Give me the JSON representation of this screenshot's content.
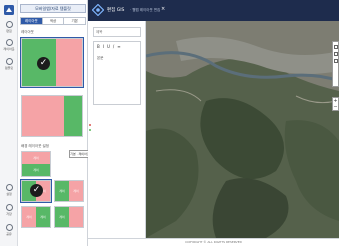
{
  "app": {
    "panel_title": "모바일앱/자료 템플릿",
    "header_title": "편집 GIS",
    "header_subtitle": "· 웹맵 레이아웃 편집",
    "footer_text": "COPYRIGHT © ALL RIGHTS RESERVED",
    "close_glyph": "×",
    "zoom_label": "+\n−"
  },
  "rail": {
    "items": [
      {
        "label": "편집",
        "icon": "home-icon"
      },
      {
        "label": "레이아웃",
        "icon": "layout-icon"
      },
      {
        "label": "템플릿",
        "icon": "template-icon"
      },
      {
        "label": "설정",
        "icon": "settings-icon"
      },
      {
        "label": "저장",
        "icon": "save-icon"
      },
      {
        "label": "공유",
        "icon": "share-icon"
      }
    ]
  },
  "tabs": [
    {
      "label": "레이아웃",
      "active": true
    },
    {
      "label": "색상",
      "active": false
    },
    {
      "label": "기본",
      "active": false
    }
  ],
  "sections": {
    "top_label": "레이아웃",
    "bottom_label": "배경 레이아웃 설정"
  },
  "layouts": {
    "check_glyph": "✓",
    "tooltip": "기본 · 레이아웃",
    "mini_cells": [
      "레이",
      "레이",
      "레이",
      "레이",
      "레이",
      "레이",
      "레이",
      "레이"
    ]
  },
  "tools": {
    "title_placeholder": "제목",
    "format_bar": [
      "B",
      "I",
      "U",
      "/",
      "≡"
    ],
    "body_label": "본문"
  },
  "colors": {
    "accent": "#2f5aa8",
    "header_bg": "#1e2c4d",
    "layout_green": "#58b867",
    "layout_pink": "#f5a3a6"
  }
}
